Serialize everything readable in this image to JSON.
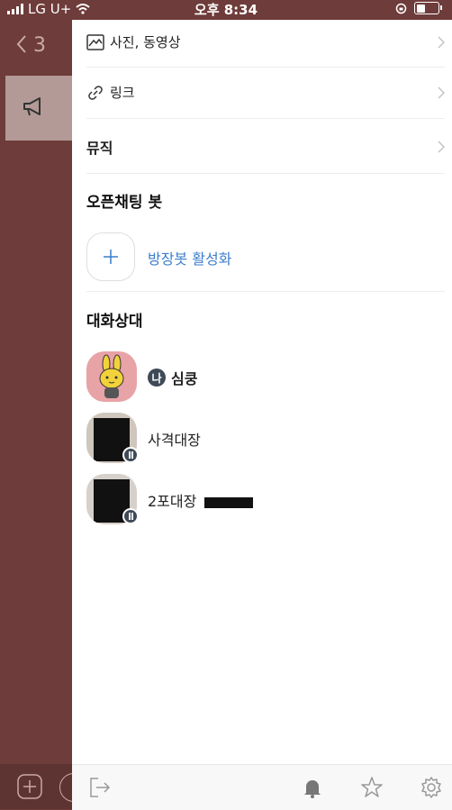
{
  "status_bar": {
    "carrier": "LG U+",
    "time": "오후 8:34"
  },
  "background": {
    "back_count": "3"
  },
  "menu": {
    "photos_videos": "사진, 동영상",
    "links": "링크",
    "music": "뮤직"
  },
  "bot_section": {
    "title": "오픈채팅 봇",
    "add_label": "방장봇 활성화"
  },
  "members_section": {
    "title": "대화상대",
    "members": [
      {
        "name": "심쿵",
        "role": "나"
      },
      {
        "name": "사격대장"
      },
      {
        "name": "2포대장"
      }
    ]
  },
  "colors": {
    "backdrop": "#6e3c3a",
    "accent_link": "#3b7dcc",
    "host_badge": "#3f4a57"
  },
  "icons": [
    "image-icon",
    "link-icon",
    "chevron-right-icon",
    "plus-icon",
    "exit-icon",
    "bell-icon",
    "star-icon",
    "gear-icon",
    "megaphone-icon",
    "add-icon"
  ]
}
